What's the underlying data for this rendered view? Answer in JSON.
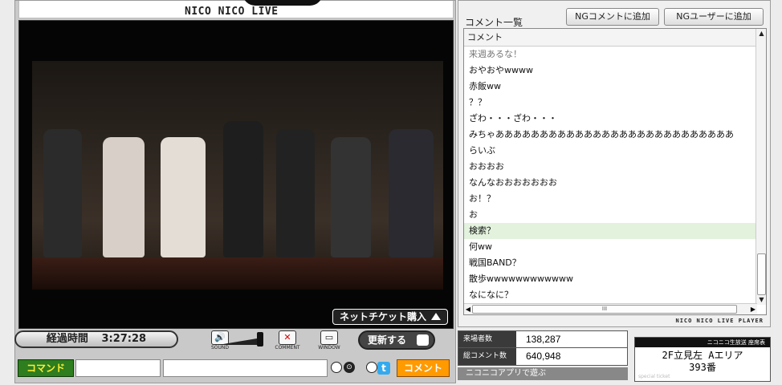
{
  "player": {
    "logo_text": "NICO NICO  LIVE",
    "ticket_label": "ネットチケット購入",
    "elapsed_label": "経過時間",
    "elapsed_value": "3:27:28",
    "controls": {
      "sound_label": "SOUND",
      "comment_label": "COMMENT",
      "window_label": "WINDOW"
    },
    "update_button": "更新する",
    "command_label": "コマンド",
    "comment_button": "コメント"
  },
  "comments": {
    "title": "コメント一覧",
    "ng_comment_button": "NGコメントに追加",
    "ng_user_button": "NGユーザーに追加",
    "column_header": "コメント",
    "rows": [
      {
        "text": "来週あるな！"
      },
      {
        "text": "おやおやwwww"
      },
      {
        "text": "赤飯ww"
      },
      {
        "text": "？？"
      },
      {
        "text": "ざわ・・・ざわ・・・"
      },
      {
        "text": "みちゃあああああああああああああああああああああああああああ"
      },
      {
        "text": "らいぶ"
      },
      {
        "text": "おおおお"
      },
      {
        "text": "なんなおおおおおおお"
      },
      {
        "text": "お！？"
      },
      {
        "text": "お"
      },
      {
        "text": "検索？"
      },
      {
        "text": "何ww"
      },
      {
        "text": "戦国BAND？"
      },
      {
        "text": "散歩wwwwwwwwwwww"
      },
      {
        "text": "なになに？"
      }
    ],
    "scroll_thumb_glyph": "III",
    "brand": "NICO NICO LIVE PLAYER"
  },
  "stats": {
    "visitors_label": "来場者数",
    "visitors_value": "138,287",
    "comments_label": "総コメント数",
    "comments_value": "640,948",
    "app_link": "ニコニコアプリで遊ぶ"
  },
  "seat": {
    "header": "ニコニコ生放送 座席表",
    "line1": "2F立見左  Aエリア",
    "line2": "393番",
    "footer": "special ticket"
  }
}
